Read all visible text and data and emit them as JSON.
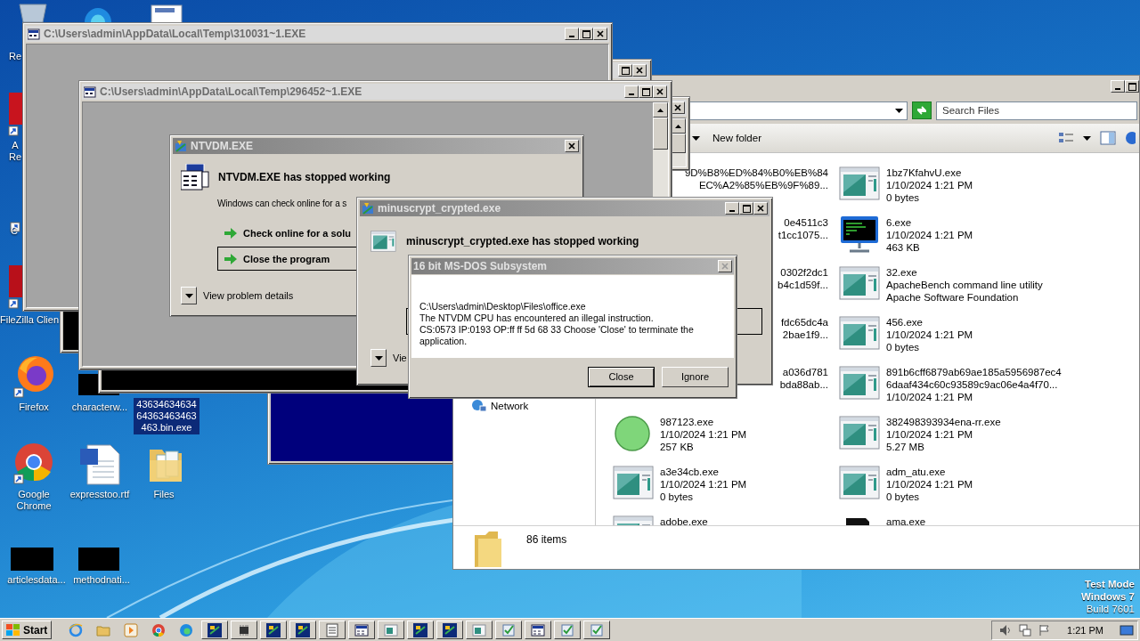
{
  "desktop": {
    "icons": [
      {
        "kind": "recycle-bin",
        "lines": [
          "Re"
        ],
        "selected": false
      },
      {
        "kind": "browser"
      },
      {
        "kind": "document"
      },
      {
        "kind": "pdf-shortcut",
        "lines": [
          "A",
          "Re"
        ],
        "selected": false
      },
      {
        "kind": "shortcut",
        "lines": [
          "C"
        ],
        "selected": false
      },
      {
        "kind": "ftp-shortcut",
        "lines": [
          "FileZilla Clien"
        ],
        "selected": false
      },
      {
        "kind": "firefox",
        "lines": [
          "Firefox"
        ],
        "selected": false
      },
      {
        "kind": "console",
        "lines": [
          "characterw..."
        ],
        "selected": false
      },
      {
        "kind": "hidden",
        "lines": [
          "43634634634",
          "64363463463",
          "463.bin.exe"
        ],
        "selected": true
      },
      {
        "kind": "chrome",
        "lines": [
          "Google",
          "Chrome"
        ],
        "selected": false
      },
      {
        "kind": "word",
        "lines": [
          "expresstoo.rtf"
        ],
        "selected": false
      },
      {
        "kind": "folder",
        "lines": [
          "Files"
        ],
        "selected": false
      },
      {
        "kind": "console",
        "lines": [
          "articlesdata..."
        ],
        "selected": false
      },
      {
        "kind": "console",
        "lines": [
          "methodnati..."
        ],
        "selected": false
      }
    ],
    "build_info": [
      "Test Mode",
      "Windows 7",
      "Build 7601"
    ]
  },
  "explorer": {
    "search": {
      "placeholder": "Search Files"
    },
    "toolbar": [
      "New folder"
    ],
    "nav": [
      {
        "label": "Network"
      }
    ],
    "files": [
      {
        "kind": "obscured",
        "lines": [
          "9D%B8%ED%84%B0%EB%84",
          "EC%A2%85%EB%9F%89..."
        ]
      },
      {
        "kind": "exe",
        "lines": [
          "1bz7KfahvU.exe",
          "1/10/2024 1:21 PM",
          "0 bytes"
        ]
      },
      {
        "kind": "obscured",
        "lines": [
          "0e4511c3",
          "t1cc1075..."
        ]
      },
      {
        "kind": "terminal",
        "lines": [
          "6.exe",
          "1/10/2024 1:21 PM",
          "463 KB"
        ]
      },
      {
        "kind": "obscured",
        "lines": [
          "0302f2dc1",
          "b4c1d59f..."
        ]
      },
      {
        "kind": "exe",
        "lines": [
          "32.exe",
          "ApacheBench command line utility",
          "Apache Software Foundation"
        ]
      },
      {
        "kind": "obscured",
        "lines": [
          "fdc65dc4a",
          "2bae1f9..."
        ]
      },
      {
        "kind": "exe",
        "lines": [
          "456.exe",
          "1/10/2024 1:21 PM",
          "0 bytes"
        ]
      },
      {
        "kind": "obscured",
        "lines": [
          "a036d781",
          "bda88ab..."
        ]
      },
      {
        "kind": "exe",
        "lines": [
          "891b6cff6879ab69ae185a5956987ec4",
          "6daaf434c60c93589c9ac06e4a4f70...",
          "1/10/2024 1:21 PM"
        ]
      },
      {
        "kind": "orb",
        "lines": [
          "987123.exe",
          "1/10/2024 1:21 PM",
          "257 KB"
        ]
      },
      {
        "kind": "exe",
        "lines": [
          "382498393934ena-rr.exe",
          "1/10/2024 1:21 PM",
          "5.27 MB"
        ]
      },
      {
        "kind": "exe",
        "lines": [
          "a3e34cb.exe",
          "1/10/2024 1:21 PM",
          "0 bytes"
        ]
      },
      {
        "kind": "exe",
        "lines": [
          "adm_atu.exe",
          "1/10/2024 1:21 PM",
          "0 bytes"
        ]
      },
      {
        "kind": "exe",
        "lines": [
          "adobe.exe"
        ]
      },
      {
        "kind": "box",
        "lines": [
          "ama.exe"
        ]
      }
    ],
    "status": "86 items"
  },
  "windows": [
    {
      "kind": "console",
      "title": "C:\\Users\\admin\\AppData\\Local\\Temp\\310031~1.EXE"
    },
    {
      "kind": "console-scroll",
      "title": "C:\\Users\\admin\\AppData\\Local\\Temp\\296452~1.EXE"
    }
  ],
  "ntvdm_dialog": {
    "title": "NTVDM.EXE",
    "heading": "NTVDM.EXE has stopped working",
    "description": "Windows can check online for a s",
    "options": [
      {
        "label": "Check online for a solu",
        "selected": false
      },
      {
        "label": "Close the program",
        "selected": true
      }
    ],
    "details": "View problem details"
  },
  "crash_dialog": {
    "title": "minuscrypt_crypted.exe",
    "heading": "minuscrypt_crypted.exe has stopped working",
    "details": "Vie"
  },
  "msdos_dialog": {
    "title": "16 bit MS-DOS Subsystem",
    "message": [
      "C:\\Users\\admin\\Desktop\\Files\\office.exe",
      "The NTVDM CPU has encountered an illegal instruction.",
      "CS:0573 IP:0193 OP:ff ff 5d 68 33 Choose 'Close' to terminate the application."
    ],
    "buttons": [
      {
        "label": "Close",
        "selected": true
      },
      {
        "label": "Ignore",
        "selected": false
      }
    ]
  },
  "taskbar": {
    "start": "Start",
    "clock": "1:21 PM"
  }
}
